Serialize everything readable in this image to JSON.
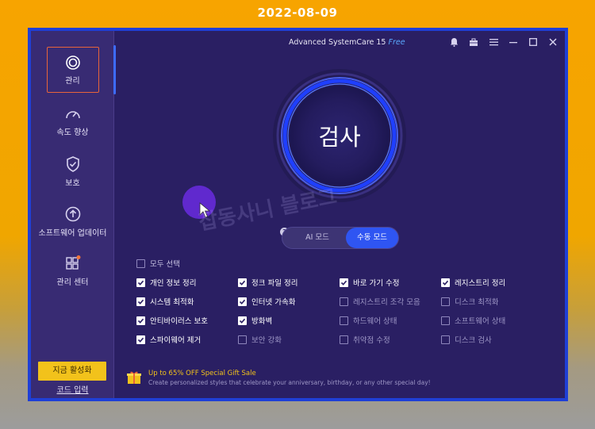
{
  "date_caption": "2022-08-09",
  "titlebar": {
    "app_name": "Advanced SystemCare 15",
    "edition": "Free",
    "icons": [
      "bell-icon",
      "toolbox-icon",
      "menu-icon",
      "minimize-icon",
      "maximize-icon",
      "close-icon"
    ]
  },
  "sidebar": {
    "items": [
      {
        "label": "관리",
        "icon": "care-icon",
        "active": true
      },
      {
        "label": "속도 향상",
        "icon": "speedometer-icon",
        "active": false
      },
      {
        "label": "보호",
        "icon": "shield-icon",
        "active": false
      },
      {
        "label": "소프트웨어 업데이터",
        "icon": "update-icon",
        "active": false
      },
      {
        "label": "관리 센터",
        "icon": "grid-icon",
        "active": false
      }
    ],
    "activate_label": "지금 활성화",
    "code_label": "코드 입력"
  },
  "main": {
    "scan_label": "검사",
    "mode": {
      "ai_label": "AI 모드",
      "manual_label": "수동 모드",
      "selected": "manual"
    },
    "select_all_label": "모두 선택",
    "checks": [
      [
        {
          "label": "개인 정보 정리",
          "checked": true
        },
        {
          "label": "정크 파일 정리",
          "checked": true
        },
        {
          "label": "바로 가기 수정",
          "checked": true
        },
        {
          "label": "레지스트리 정리",
          "checked": true
        }
      ],
      [
        {
          "label": "시스템 최적화",
          "checked": true
        },
        {
          "label": "인터넷 가속화",
          "checked": true
        },
        {
          "label": "레지스트리 조각 모음",
          "checked": false
        },
        {
          "label": "디스크 최적화",
          "checked": false
        }
      ],
      [
        {
          "label": "안티바이러스 보호",
          "checked": true
        },
        {
          "label": "방화벽",
          "checked": true
        },
        {
          "label": "하드웨어 상태",
          "checked": false
        },
        {
          "label": "소프트웨어 상태",
          "checked": false
        }
      ],
      [
        {
          "label": "스파이웨어 제거",
          "checked": true
        },
        {
          "label": "보안 강화",
          "checked": false
        },
        {
          "label": "취약점 수정",
          "checked": false
        },
        {
          "label": "디스크 검사",
          "checked": false
        }
      ]
    ],
    "promo": {
      "icon": "gift-icon",
      "title": "Up to 65% OFF Special Gift Sale",
      "subtitle": "Create personalized styles that celebrate your anniversary, birthday, or any other special day!"
    }
  },
  "watermark_text": "잡동사니 블로그",
  "colors": {
    "accent": "#2f55f2",
    "activate": "#f2c21b",
    "frame": "#1f3fd6",
    "active_outline": "#e8643a"
  }
}
